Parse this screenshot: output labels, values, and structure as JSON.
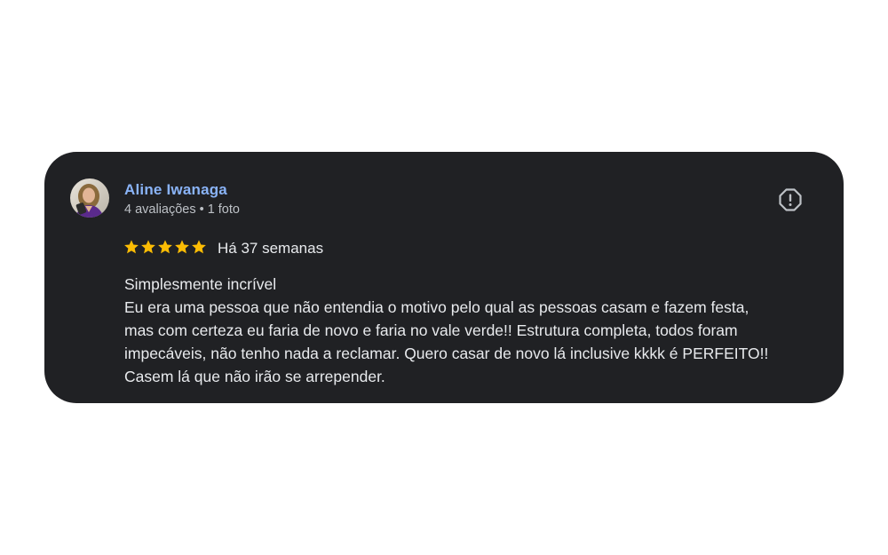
{
  "review": {
    "author": "Aline Iwanaga",
    "stats": {
      "reviews": "4 avaliações",
      "separator": "•",
      "photos": "1 foto"
    },
    "rating": 5,
    "rating_max": 5,
    "date": "Há 37 semanas",
    "text_lines": [
      "Simplesmente incrível",
      "Eu era uma pessoa que não entendia o motivo pelo qual as pessoas casam e fazem festa,",
      "mas com certeza eu faria de novo e faria no vale verde!! Estrutura completa, todos foram",
      "impecáveis, não tenho nada a reclamar. Quero casar de novo lá inclusive kkkk é PERFEITO!!",
      "Casem lá que não irão se arrepender."
    ]
  },
  "icons": {
    "report": "report-icon",
    "star": "star-icon"
  },
  "colors": {
    "card_bg": "#202124",
    "author": "#8ab4f8",
    "star": "#fbbc04",
    "text": "#e8eaed",
    "secondary": "#bdc1c6"
  }
}
